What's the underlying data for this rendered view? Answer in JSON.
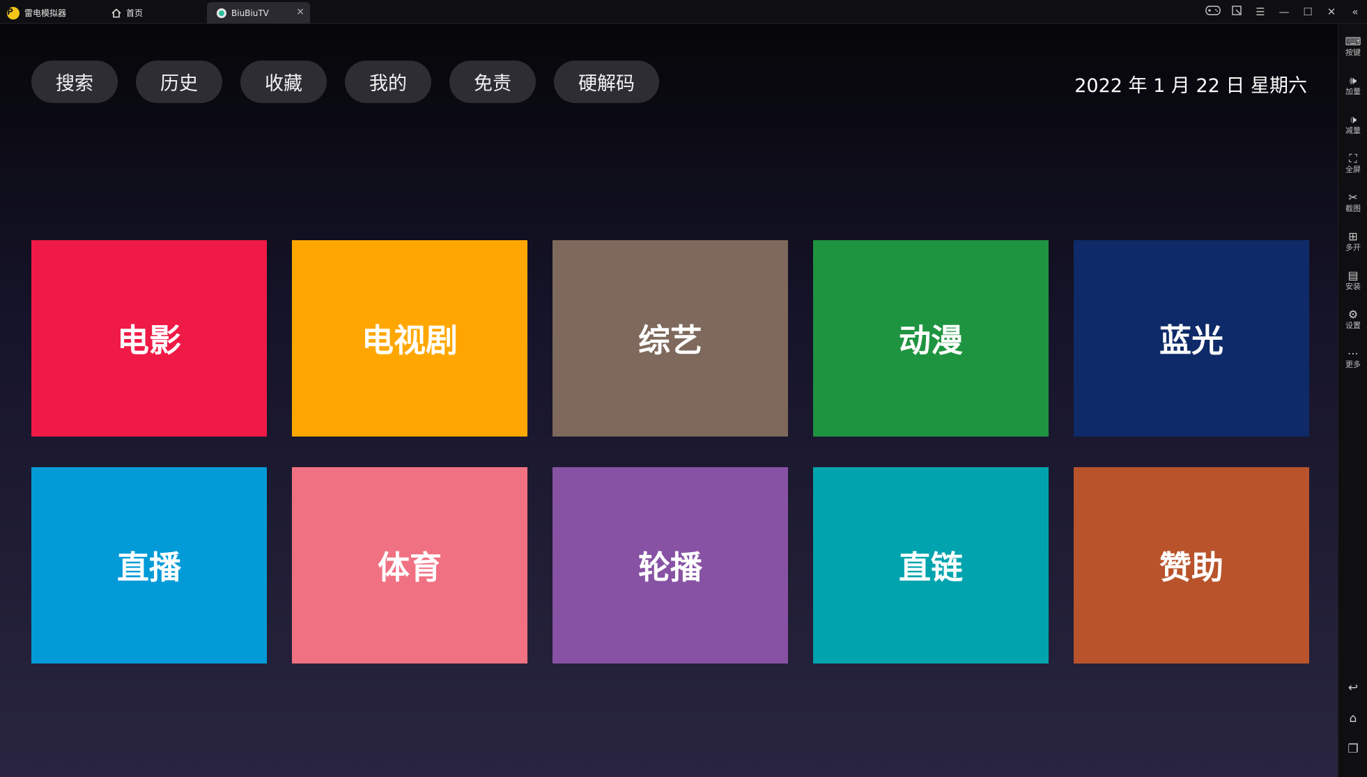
{
  "titlebar": {
    "app_name": "雷电模拟器",
    "home_tab": "首页",
    "active_tab": "BiuBiuTV",
    "close_glyph": "×"
  },
  "topnav": [
    {
      "label": "搜索"
    },
    {
      "label": "历史"
    },
    {
      "label": "收藏"
    },
    {
      "label": "我的"
    },
    {
      "label": "免责"
    },
    {
      "label": "硬解码"
    }
  ],
  "date": "2022 年 1 月 22 日 星期六",
  "tiles": [
    {
      "label": "电影",
      "color": "#f01a46"
    },
    {
      "label": "电视剧",
      "color": "#ffa700"
    },
    {
      "label": "综艺",
      "color": "#7e695c"
    },
    {
      "label": "动漫",
      "color": "#1f9440"
    },
    {
      "label": "蓝光",
      "color": "#0e2a68"
    },
    {
      "label": "直播",
      "color": "#029bd8"
    },
    {
      "label": "体育",
      "color": "#f07182"
    },
    {
      "label": "轮播",
      "color": "#8752a4"
    },
    {
      "label": "直链",
      "color": "#01a4ae"
    },
    {
      "label": "赞助",
      "color": "#b8532b"
    }
  ],
  "sidebar": [
    {
      "label": "按键",
      "icon": "keyboard-icon"
    },
    {
      "label": "加量",
      "icon": "volume-up-icon"
    },
    {
      "label": "减量",
      "icon": "volume-down-icon"
    },
    {
      "label": "全屏",
      "icon": "fullscreen-icon"
    },
    {
      "label": "截图",
      "icon": "scissors-icon"
    },
    {
      "label": "多开",
      "icon": "multi-instance-icon"
    },
    {
      "label": "安装",
      "icon": "apk-install-icon"
    },
    {
      "label": "设置",
      "icon": "gear-icon"
    },
    {
      "label": "更多",
      "icon": "more-icon"
    }
  ]
}
